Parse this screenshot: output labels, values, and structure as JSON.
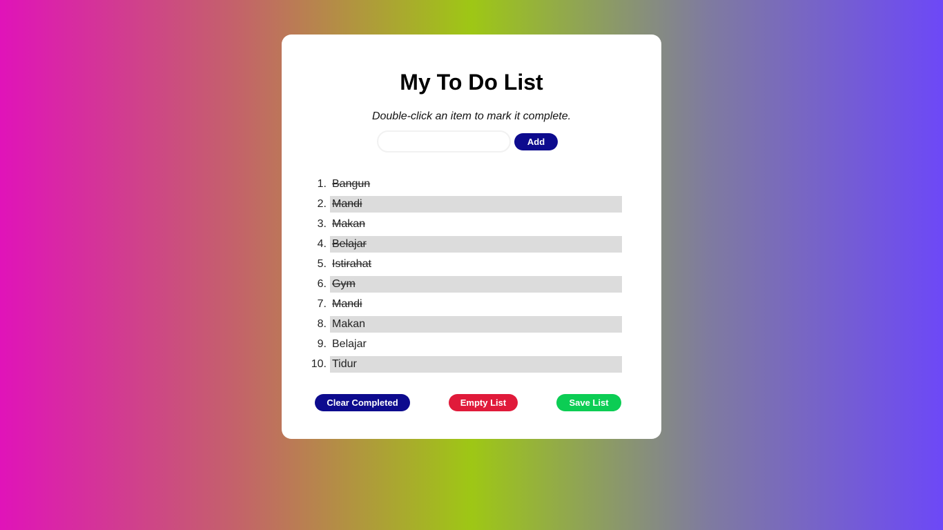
{
  "app": {
    "title": "My To Do List",
    "hint": "Double-click an item to mark it complete."
  },
  "input": {
    "value": "",
    "placeholder": "",
    "add_label": "Add"
  },
  "todos": [
    {
      "num": "1.",
      "text": "Bangun",
      "done": true
    },
    {
      "num": "2.",
      "text": "Mandi",
      "done": true
    },
    {
      "num": "3.",
      "text": "Makan",
      "done": true
    },
    {
      "num": "4.",
      "text": "Belajar",
      "done": true
    },
    {
      "num": "5.",
      "text": "Istirahat",
      "done": true
    },
    {
      "num": "6.",
      "text": "Gym",
      "done": true
    },
    {
      "num": "7.",
      "text": "Mandi",
      "done": true
    },
    {
      "num": "8.",
      "text": "Makan",
      "done": false
    },
    {
      "num": "9.",
      "text": "Belajar",
      "done": false
    },
    {
      "num": "10.",
      "text": "Tidur",
      "done": false
    }
  ],
  "buttons": {
    "clear_completed": "Clear Completed",
    "empty_list": "Empty List",
    "save_list": "Save List"
  },
  "colors": {
    "primary": "#0d0b8e",
    "danger": "#e01a3a",
    "success": "#0ccd54",
    "stripe": "#dcdcdc"
  }
}
